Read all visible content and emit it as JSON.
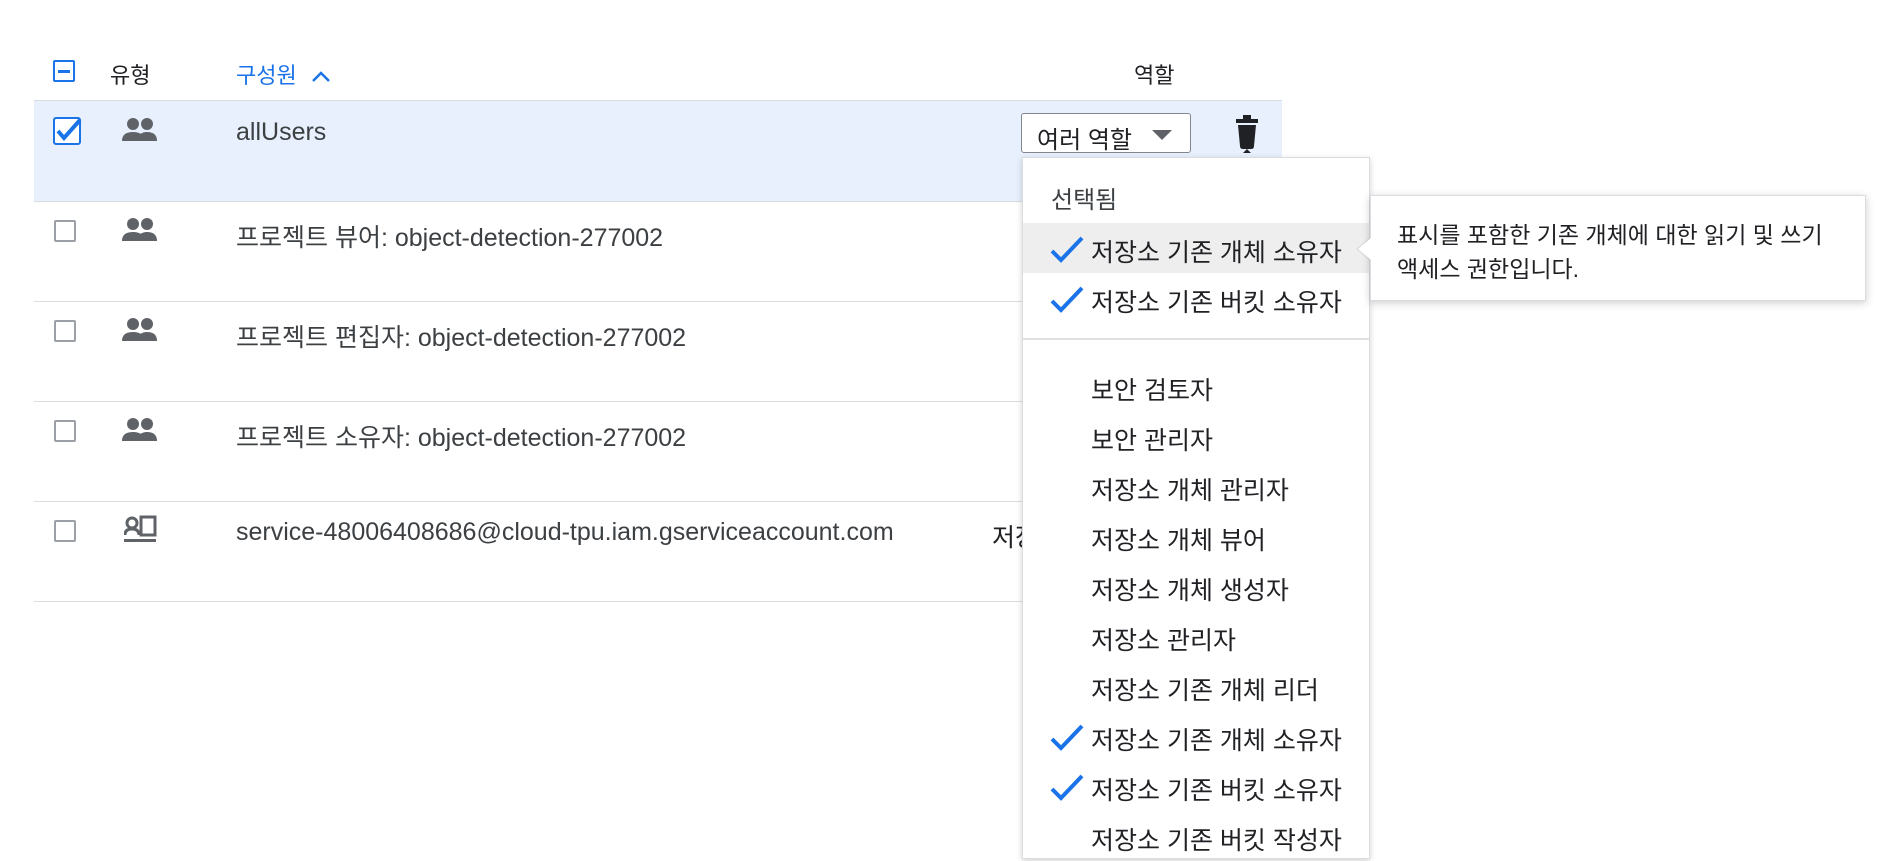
{
  "header": {
    "type_label": "유형",
    "member_label": "구성원",
    "role_label": "역할"
  },
  "rows": [
    {
      "member": "allUsers",
      "selected": true,
      "icon": "group-icon"
    },
    {
      "member": "프로젝트 뷰어: object-detection-277002",
      "selected": false,
      "icon": "group-icon"
    },
    {
      "member": "프로젝트 편집자: object-detection-277002",
      "selected": false,
      "icon": "group-icon"
    },
    {
      "member": "프로젝트 소유자: object-detection-277002",
      "selected": false,
      "icon": "group-icon"
    },
    {
      "member": "service-48006408686@cloud-tpu.iam.gserviceaccount.com",
      "selected": false,
      "icon": "service-account-icon",
      "role_partial": "저장"
    }
  ],
  "role_select": {
    "label": "여러 역할"
  },
  "menu": {
    "selected_heading": "선택됨",
    "selected_items": [
      {
        "label": "저장소 기존 개체 소유자",
        "checked": true
      },
      {
        "label": "저장소 기존 버킷 소유자",
        "checked": true
      }
    ],
    "items": [
      {
        "label": "보안 검토자",
        "checked": false
      },
      {
        "label": "보안 관리자",
        "checked": false
      },
      {
        "label": "저장소 개체 관리자",
        "checked": false
      },
      {
        "label": "저장소 개체 뷰어",
        "checked": false
      },
      {
        "label": "저장소 개체 생성자",
        "checked": false
      },
      {
        "label": "저장소 관리자",
        "checked": false
      },
      {
        "label": "저장소 기존 개체 리더",
        "checked": false
      },
      {
        "label": "저장소 기존 개체 소유자",
        "checked": true
      },
      {
        "label": "저장소 기존 버킷 소유자",
        "checked": true
      },
      {
        "label": "저장소 기존 버킷 작성자",
        "checked": false
      }
    ]
  },
  "tooltip": {
    "text": "표시를 포함한 기존 개체에 대한 읽기 및 쓰기 액세스 권한입니다."
  },
  "colors": {
    "accent": "#1a73e8",
    "selected_row": "#e8f0fe",
    "icon": "#5f6368"
  }
}
